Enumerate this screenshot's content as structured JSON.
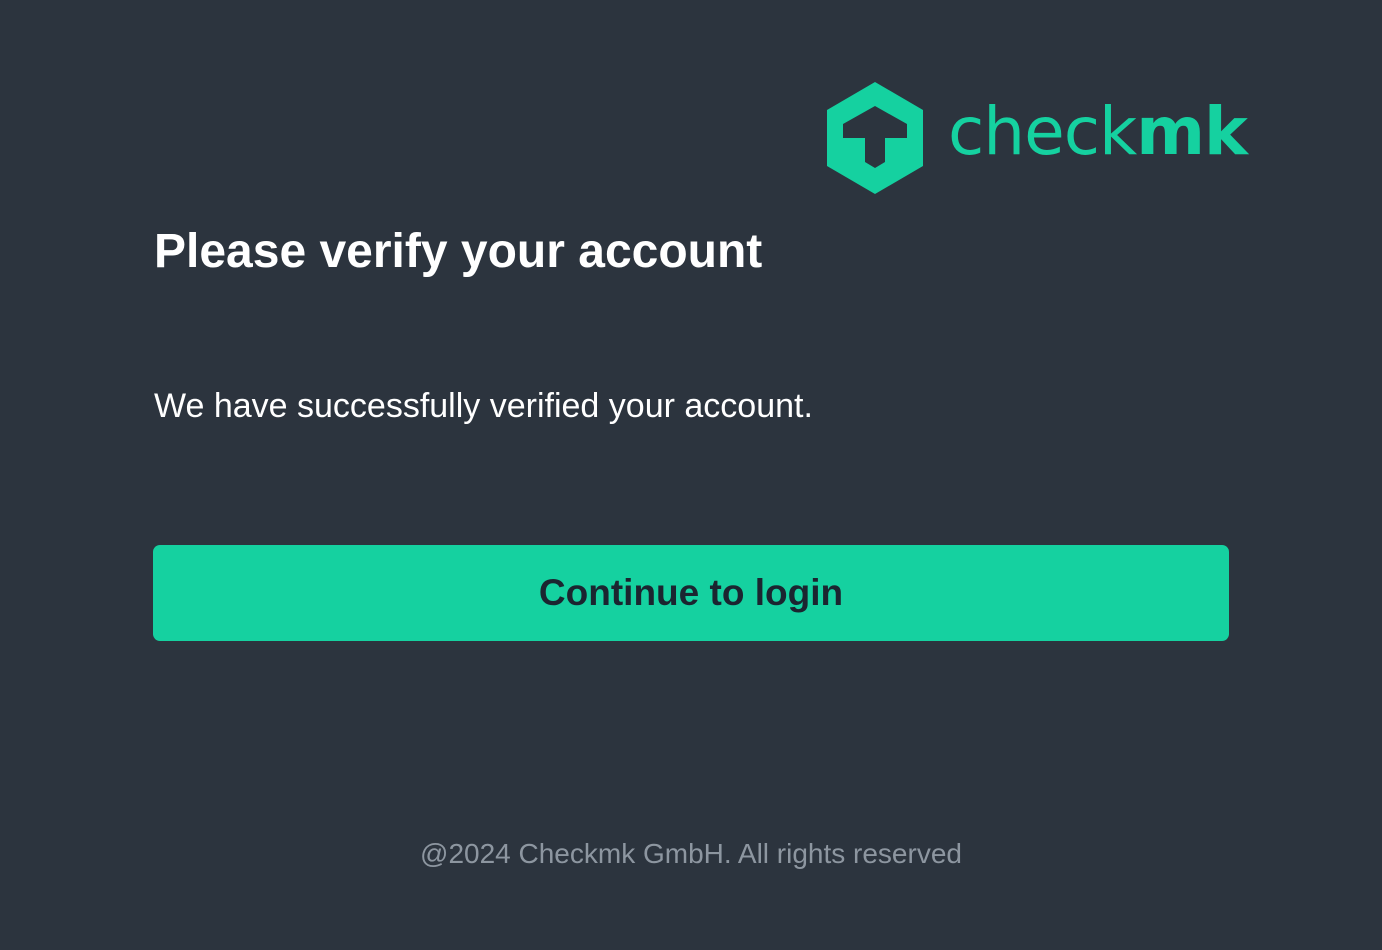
{
  "brand": {
    "name_light": "check",
    "name_bold": "mk",
    "logo_icon": "checkmk-hexagon-icon",
    "accent_color": "#15d1a0",
    "background_color": "#2c343e"
  },
  "main": {
    "title": "Please verify your account",
    "message": "We have successfully verified your account.",
    "continue_label": "Continue to login"
  },
  "footer": {
    "copyright": "@2024 Checkmk GmbH. All rights reserved"
  }
}
